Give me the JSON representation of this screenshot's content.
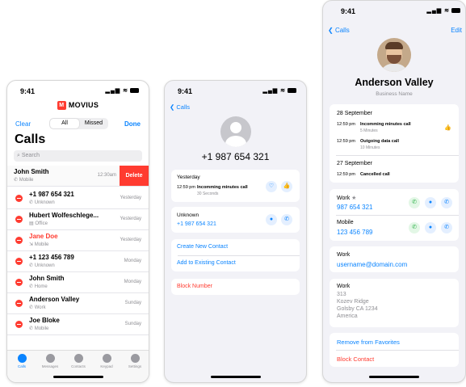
{
  "status_time": "9:41",
  "phone1": {
    "brand": "MOVIUS",
    "clear": "Clear",
    "done": "Done",
    "segments": [
      "All",
      "Missed"
    ],
    "title": "Calls",
    "search_placeholder": "Search",
    "delete_label": "Delete",
    "calls": [
      {
        "name": "John Smith",
        "type": "Mobile",
        "time": "12:30am",
        "missed": false
      },
      {
        "name": "+1 987 654 321",
        "type": "Unknown",
        "time": "Yesterday",
        "missed": false
      },
      {
        "name": "Hubert Wolfeschlege...",
        "type": "Office",
        "time": "Yesterday",
        "missed": false
      },
      {
        "name": "Jane Doe",
        "type": "Mobile",
        "time": "Yesterday",
        "missed": true
      },
      {
        "name": "+1 123 456 789",
        "type": "Unknown",
        "time": "Monday",
        "missed": false
      },
      {
        "name": "John Smith",
        "type": "Home",
        "time": "Monday",
        "missed": false
      },
      {
        "name": "Anderson Valley",
        "type": "Work",
        "time": "Sunday",
        "missed": false
      },
      {
        "name": "Joe Bloke",
        "type": "Mobile",
        "time": "Sunday",
        "missed": false
      }
    ],
    "tabs": [
      {
        "label": "Calls",
        "icon": "phone-icon"
      },
      {
        "label": "Messages",
        "icon": "message-icon"
      },
      {
        "label": "Contacts",
        "icon": "contacts-icon"
      },
      {
        "label": "Keypad",
        "icon": "keypad-icon"
      },
      {
        "label": "Settings",
        "icon": "settings-icon"
      }
    ]
  },
  "phone2": {
    "back": "Calls",
    "number": "+1 987 654 321",
    "day": "Yesterday",
    "call_time": "12:59 pm",
    "call_desc": "Incomming minutes call",
    "call_dur": "30 Seconds",
    "type_label": "Unknown",
    "type_number": "+1 987 654 321",
    "create": "Create New Contact",
    "add": "Add to Existing Contact",
    "block": "Block Number"
  },
  "phone3": {
    "back": "Calls",
    "edit": "Edit",
    "name": "Anderson Valley",
    "business": "Business Name",
    "history": [
      {
        "date": "28 September",
        "entries": [
          {
            "time": "12:59 pm",
            "desc": "Incomming minutes call",
            "dur": "5 Minutes"
          },
          {
            "time": "12:59 pm",
            "desc": "Outgoing data call",
            "dur": "10 Minutes"
          }
        ]
      },
      {
        "date": "27 September",
        "entries": [
          {
            "time": "12:59 pm",
            "desc": "Cancelled call",
            "dur": ""
          }
        ]
      }
    ],
    "phones": [
      {
        "label": "Work",
        "number": "987 654 321",
        "favorite": true
      },
      {
        "label": "Mobile",
        "number": "123 456 789",
        "favorite": false
      }
    ],
    "email_label": "Work",
    "email": "username@domain.com",
    "address_label": "Work",
    "address": [
      "313",
      "Kozev Ridge",
      "Golsby CA 1234",
      "America"
    ],
    "remove_fav": "Remove from Favorites",
    "block": "Block Contact"
  }
}
